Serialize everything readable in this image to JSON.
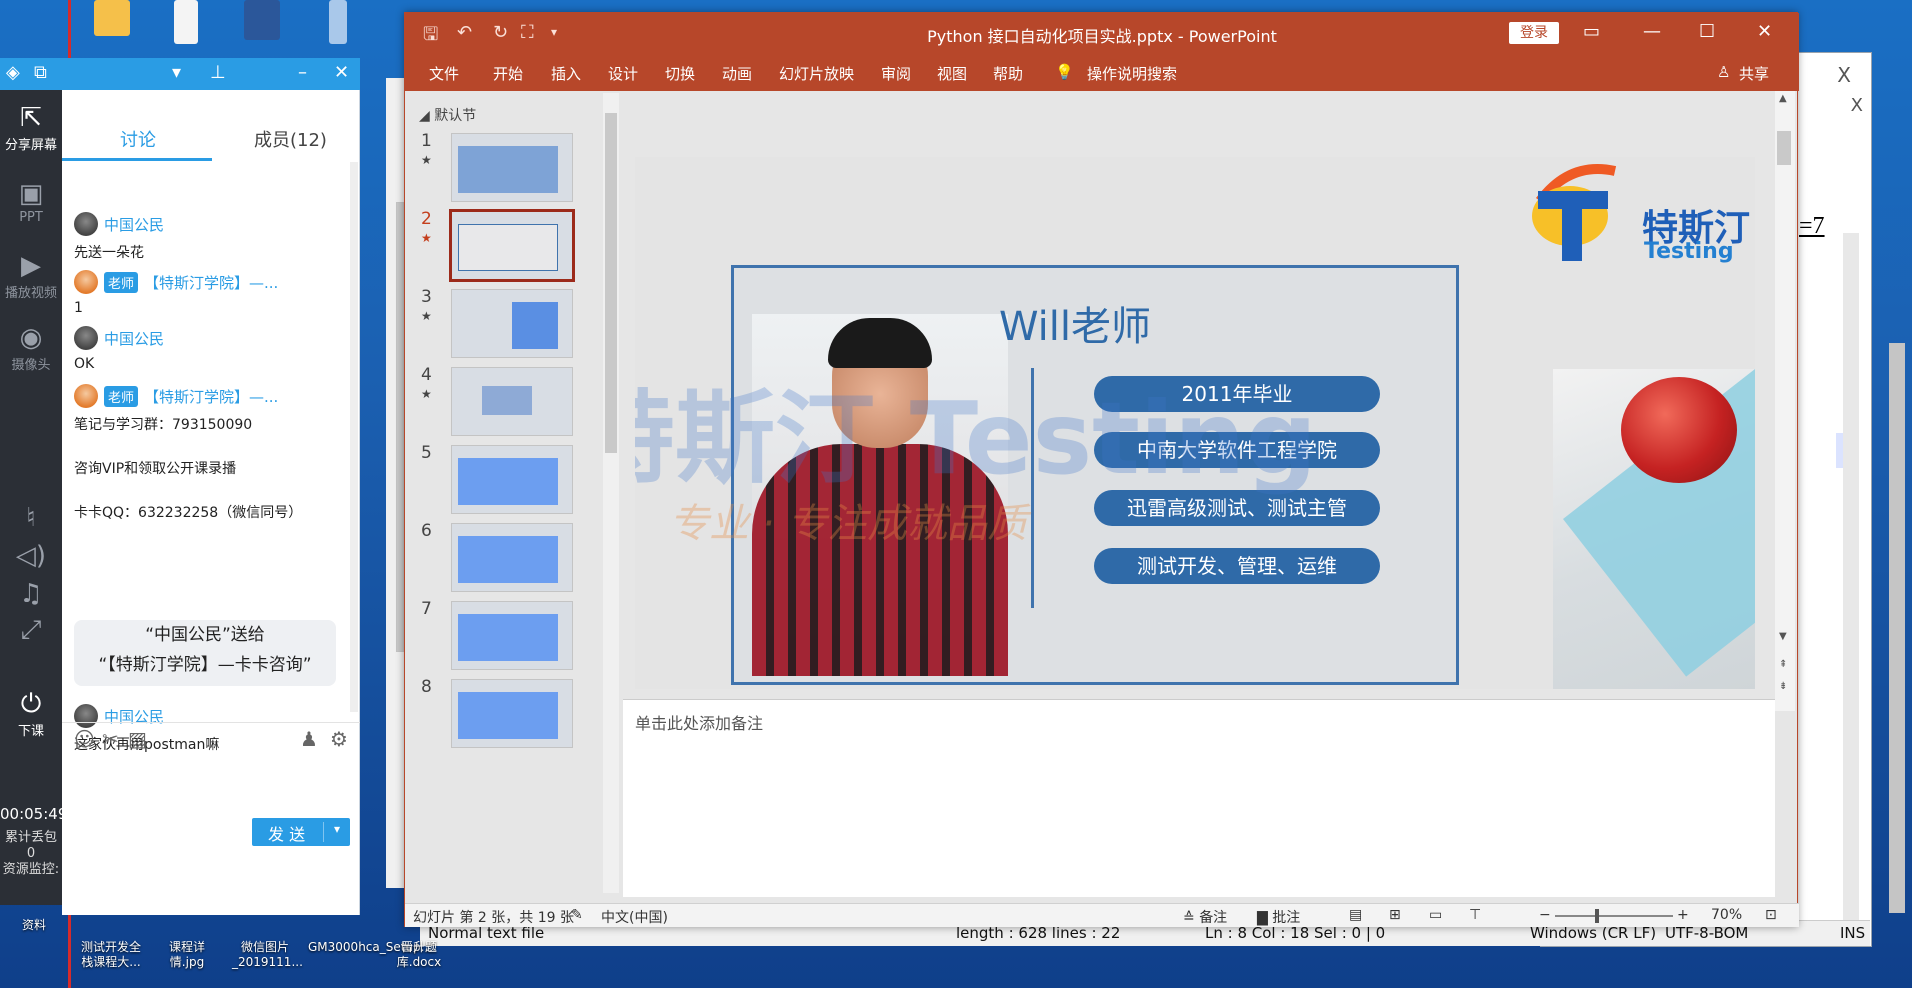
{
  "desktop": {
    "bottom_icons": [
      {
        "label": "资料"
      },
      {
        "label": "测试开发全栈课程大..."
      },
      {
        "label": "课程详情.jpg"
      },
      {
        "label": "微信图片_2019111..."
      },
      {
        "label": "GM3000hca_Setup...."
      },
      {
        "label": "晋升题库.docx"
      }
    ],
    "top_texts": [
      "分享屏幕"
    ]
  },
  "left_toolbar": {
    "share_screen": "分享屏幕",
    "ppt": "PPT",
    "play_video": "播放视频",
    "camera": "摄像头",
    "end_class": "下课",
    "timer": "00:05:49",
    "loss_label": "累计丢包",
    "loss_value": "0",
    "monitor": "资源监控:"
  },
  "chat": {
    "tabs": [
      {
        "label": "讨论"
      },
      {
        "label": "成员(12)"
      }
    ],
    "messages": [
      {
        "sender": "中国公民",
        "text": "先送一朵花"
      },
      {
        "sender": "【特斯汀学院】—...",
        "badge": "老师",
        "text": "1"
      },
      {
        "sender": "中国公民",
        "text": "OK"
      },
      {
        "sender": "【特斯汀学院】—...",
        "badge": "老师",
        "lines": [
          "笔记与学习群：793150090",
          "咨询VIP和领取公开课录播",
          "卡卡QQ：632232258（微信同号）"
        ]
      }
    ],
    "gift_line1": "“中国公民”送给",
    "gift_line2": "“【特斯汀学院】—卡卡咨询”",
    "last_sender": "中国公民",
    "last_text": "这家伙再用postman嘛",
    "send_button": "发 送"
  },
  "ppt": {
    "title": "Python 接口自动化项目实战.pptx  -  PowerPoint",
    "login": "登录",
    "menu": [
      "文件",
      "开始",
      "插入",
      "设计",
      "切换",
      "动画",
      "幻灯片放映",
      "审阅",
      "视图",
      "帮助",
      "操作说明搜索"
    ],
    "share": "共享",
    "section": "默认节",
    "slide_numbers": [
      "1",
      "2",
      "3",
      "4",
      "5",
      "6",
      "7",
      "8"
    ],
    "selected_slide": 2,
    "slide": {
      "heading": "Will老师",
      "pills": [
        "2011年毕业",
        "中南大学软件工程学院",
        "迅雷高级测试、测试主管",
        "测试开发、管理、运维"
      ],
      "logo_cn": "特斯汀",
      "logo_en": "Testing",
      "watermark": "特斯汀 Testing",
      "watermark_slogan": "专业 · 专注成就品质"
    },
    "notes_placeholder": "单击此处添加备注",
    "status": {
      "slide_info": "幻灯片 第 2 张，共 19 张",
      "language": "中文(中国)",
      "notes": "备注",
      "comments": "批注",
      "zoom": "70%"
    }
  },
  "notepad": {
    "text_fragment": "=7",
    "close": "X",
    "status": {
      "type": "Normal text file",
      "length": "length : 628    lines : 22",
      "position": "Ln : 8    Col : 18    Sel : 0 | 0",
      "eol": "Windows (CR LF)",
      "encoding": "UTF-8-BOM",
      "ins": "INS"
    }
  },
  "colors": {
    "ppt_accent": "#b7472a",
    "chat_accent": "#2a9ce4",
    "slide_blue": "#2f6aa8"
  }
}
